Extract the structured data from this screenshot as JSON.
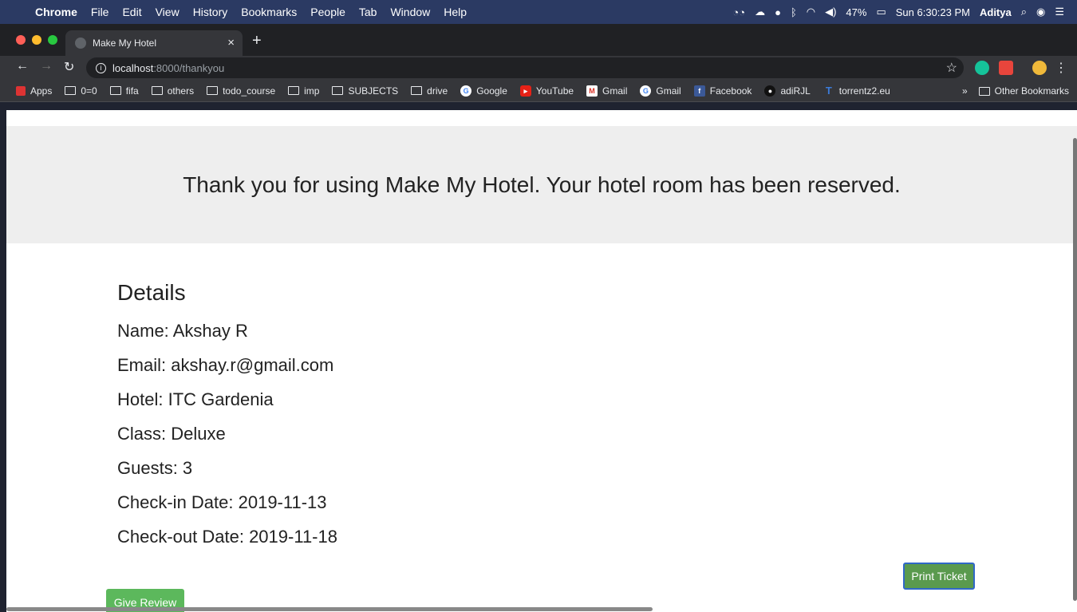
{
  "menubar": {
    "app": "Chrome",
    "items": [
      "File",
      "Edit",
      "View",
      "History",
      "Bookmarks",
      "People",
      "Tab",
      "Window",
      "Help"
    ],
    "battery": "47%",
    "clock": "Sun 6:30:23 PM",
    "user": "Aditya"
  },
  "tab": {
    "title": "Make My Hotel",
    "close": "×",
    "new": "+"
  },
  "address": {
    "host": "localhost",
    "path": ":8000/thankyou"
  },
  "bookmarks": {
    "items": [
      "Apps",
      "0=0",
      "fifa",
      "others",
      "todo_course",
      "imp",
      "SUBJECTS",
      "drive",
      "Google",
      "YouTube",
      "Gmail",
      "Gmail",
      "Facebook",
      "adiRJL",
      "torrentz2.eu"
    ],
    "overflow": "»",
    "other": "Other Bookmarks"
  },
  "page": {
    "thanks": "Thank you for using Make My Hotel. Your hotel room has been reserved.",
    "details_title": "Details",
    "details": [
      "Name: Akshay R",
      "Email: akshay.r@gmail.com",
      "Hotel: ITC Gardenia",
      "Class: Deluxe",
      "Guests: 3",
      "Check-in Date: 2019-11-13",
      "Check-out Date: 2019-11-18"
    ],
    "print_button": "Print Ticket",
    "review_button": "Give Review"
  },
  "colors": {
    "print_btn": "#5a9a4e",
    "review_btn": "#5cb85c",
    "header_band": "#eeeeee"
  }
}
